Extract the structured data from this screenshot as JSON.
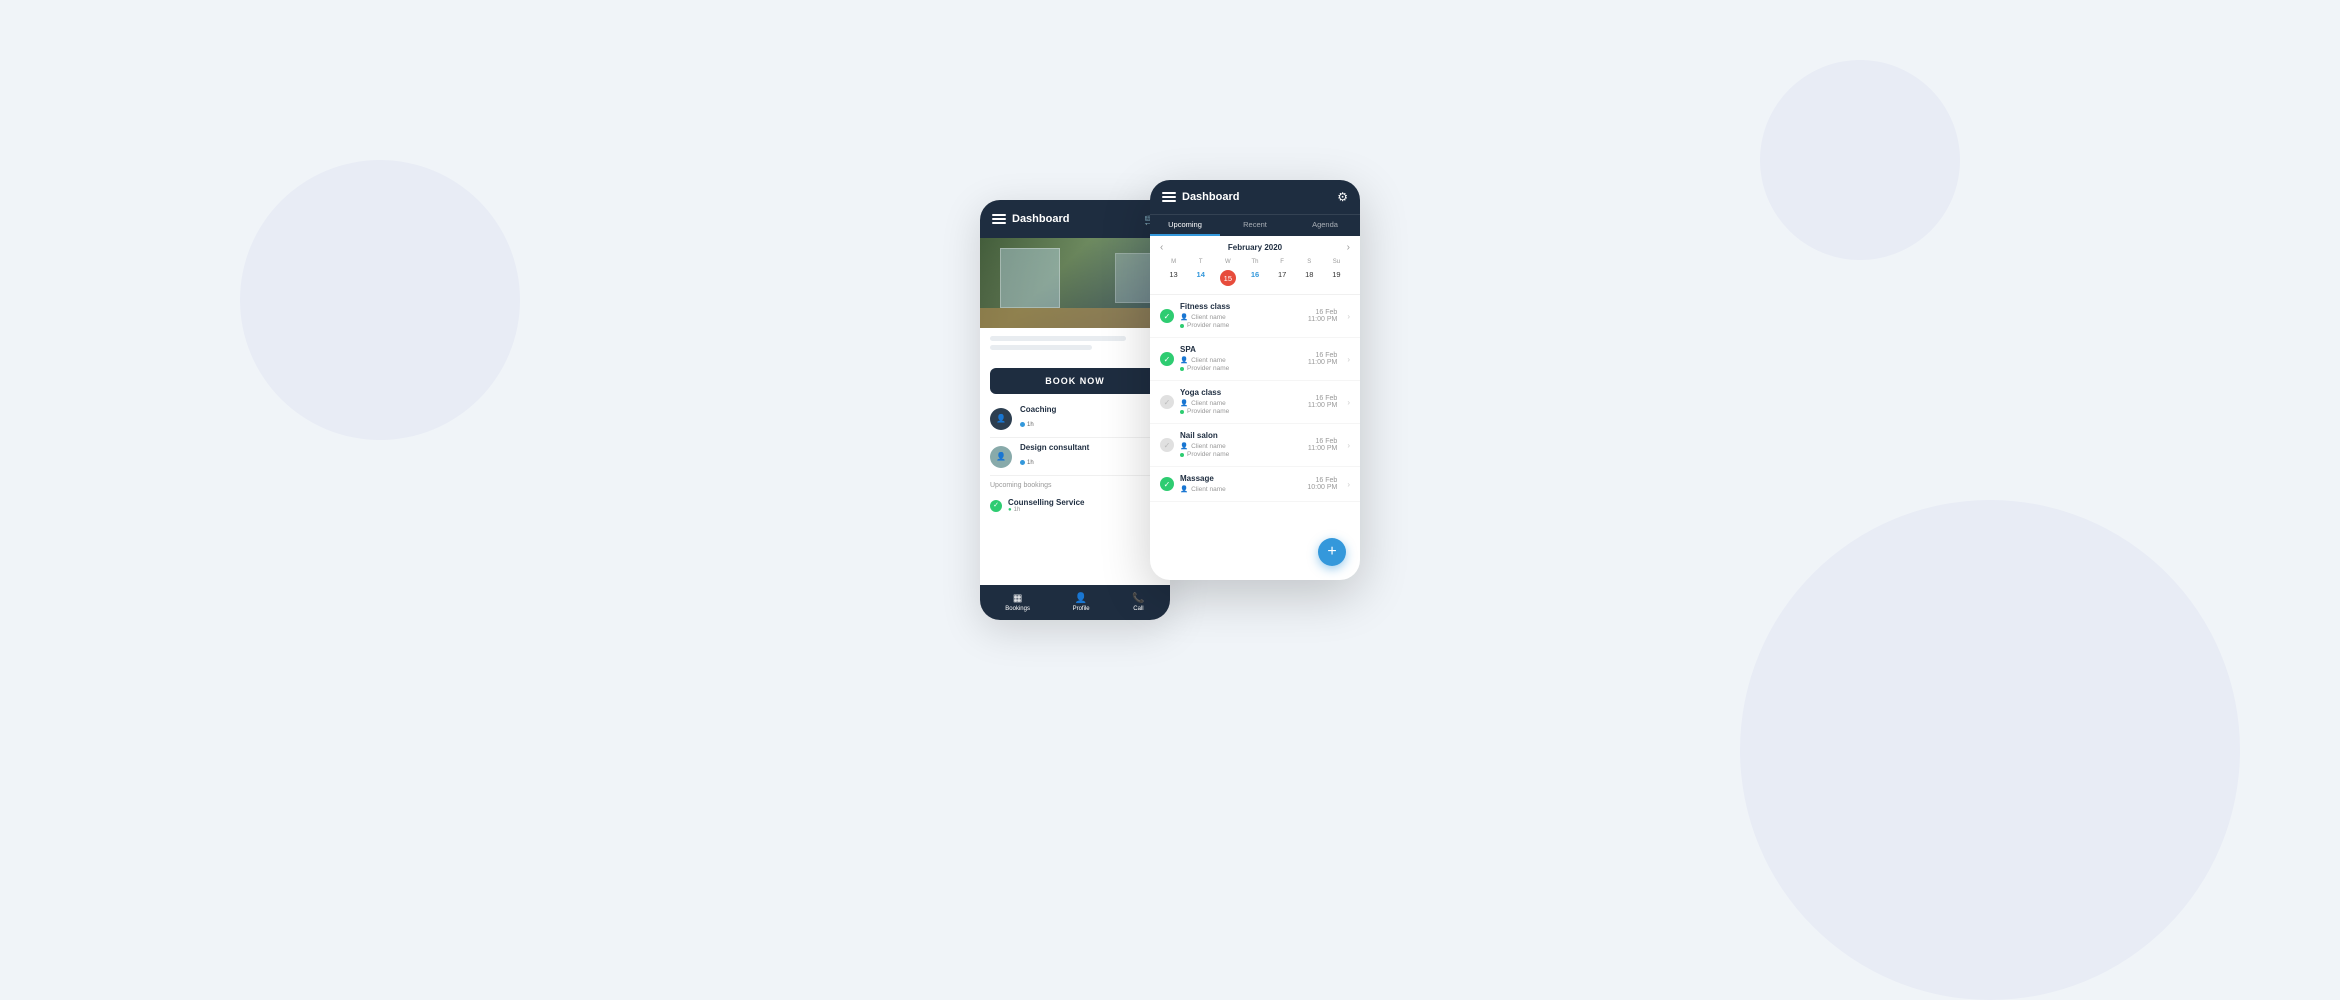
{
  "background": {
    "color": "#f0f4f8"
  },
  "phone_left": {
    "header": {
      "title": "Dashboard",
      "cart_badge": true
    },
    "book_now_label": "BOOK NOW",
    "services": [
      {
        "name": "Coaching",
        "badge_text": "1h",
        "badge_color": "blue",
        "has_dark_avatar": true
      },
      {
        "name": "Design consultant",
        "badge_text": "1h",
        "badge_color": "blue",
        "has_dark_avatar": false
      }
    ],
    "upcoming_section": {
      "title": "Upcoming bookings",
      "items": [
        {
          "name": "Counselling Service",
          "time": "1h",
          "checked": true
        }
      ]
    },
    "footer": {
      "items": [
        {
          "icon": "▦",
          "label": "Bookings"
        },
        {
          "icon": "👤",
          "label": "Profile"
        },
        {
          "icon": "📞",
          "label": "Call"
        }
      ]
    }
  },
  "phone_right": {
    "header": {
      "title": "Dashboard"
    },
    "tabs": [
      {
        "label": "Upcoming",
        "active": true
      },
      {
        "label": "Recent",
        "active": false
      },
      {
        "label": "Agenda",
        "active": false
      }
    ],
    "calendar": {
      "month": "February 2020",
      "day_labels": [
        "M",
        "T",
        "W",
        "Th",
        "F",
        "S",
        "Su"
      ],
      "dates": [
        {
          "value": "13",
          "type": "normal"
        },
        {
          "value": "14",
          "type": "highlighted"
        },
        {
          "value": "15",
          "type": "today"
        },
        {
          "value": "16",
          "type": "highlighted"
        },
        {
          "value": "17",
          "type": "normal"
        },
        {
          "value": "18",
          "type": "normal"
        },
        {
          "value": "19",
          "type": "normal"
        }
      ]
    },
    "bookings": [
      {
        "name": "Fitness class",
        "client": "Client name",
        "provider": "Provider name",
        "date": "16 Feb",
        "time": "11:00 PM",
        "checked": true
      },
      {
        "name": "SPA",
        "client": "Client name",
        "provider": "Provider name",
        "date": "16 Feb",
        "time": "11:00 PM",
        "checked": true
      },
      {
        "name": "Yoga class",
        "client": "Client name",
        "provider": "Provider name",
        "date": "16 Feb",
        "time": "11:00 PM",
        "checked": false
      },
      {
        "name": "Nail salon",
        "client": "Client name",
        "provider": "Provider name",
        "date": "16 Feb",
        "time": "11:00 PM",
        "checked": false
      },
      {
        "name": "Massage",
        "client": "Client name",
        "provider": "",
        "date": "16 Feb",
        "time": "10:00 PM",
        "checked": true
      }
    ],
    "fab_label": "+"
  }
}
